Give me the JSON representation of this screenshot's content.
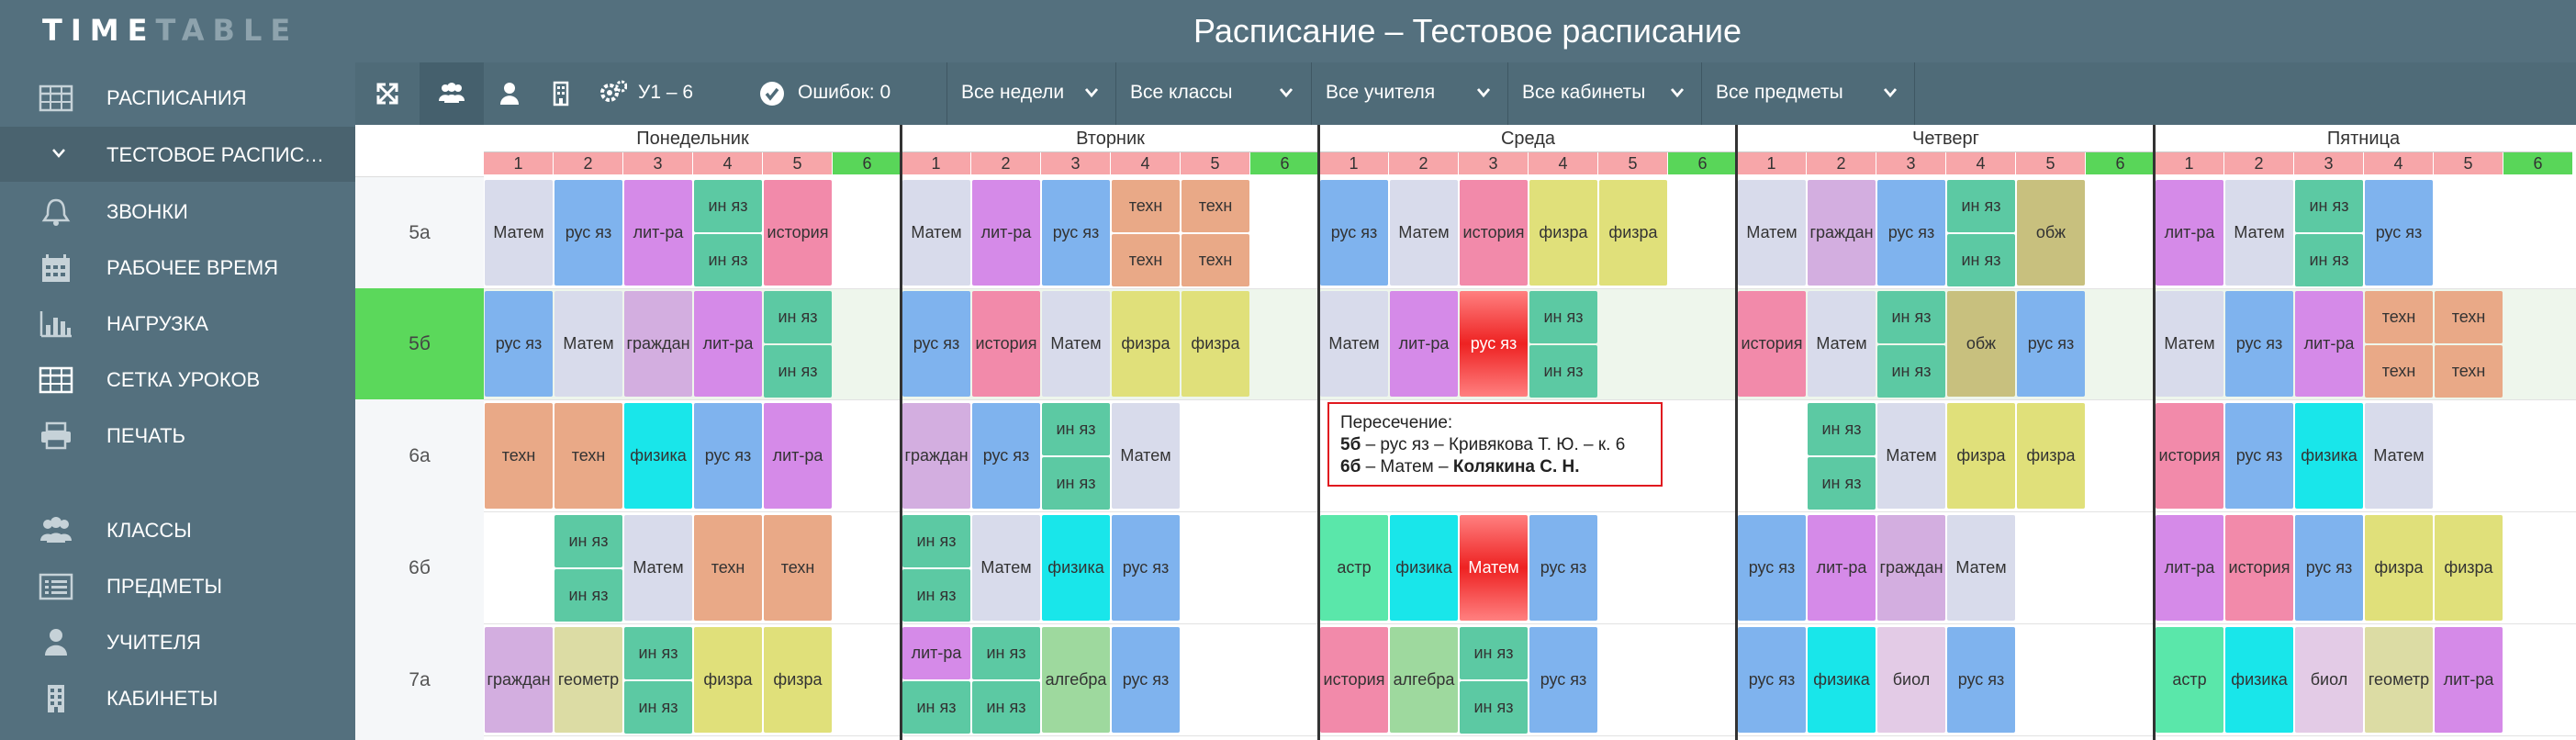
{
  "app": {
    "logo_part1": "TIME",
    "logo_part2": "TABLE",
    "title": "Расписание – Тестовое расписание"
  },
  "sidebar": {
    "items": [
      {
        "label": "РАСПИСАНИЯ",
        "icon": "table-icon"
      },
      {
        "label": "ТЕСТОВОЕ РАСПИСАНИЕ",
        "icon": "chevron-down-icon"
      },
      {
        "label": "ЗВОНКИ",
        "icon": "bell-icon"
      },
      {
        "label": "РАБОЧЕЕ ВРЕМЯ",
        "icon": "calendar-icon"
      },
      {
        "label": "НАГРУЗКА",
        "icon": "bar-chart-icon"
      },
      {
        "label": "СЕТКА УРОКОВ",
        "icon": "grid-icon"
      },
      {
        "label": "ПЕЧАТЬ",
        "icon": "printer-icon"
      },
      {
        "label": "КЛАССЫ",
        "icon": "group-icon"
      },
      {
        "label": "ПРЕДМЕТЫ",
        "icon": "list-icon"
      },
      {
        "label": "УЧИТЕЛЯ",
        "icon": "user-icon"
      },
      {
        "label": "КАБИНЕТЫ",
        "icon": "building-icon"
      }
    ]
  },
  "toolbar": {
    "range": "У1 – 6",
    "errors": "Ошибок: 0",
    "filters": [
      "Все недели",
      "Все классы",
      "Все учителя",
      "Все кабинеты",
      "Все предметы"
    ],
    "icons": [
      "expand-icon",
      "group-view-icon",
      "user-view-icon",
      "building-view-icon",
      "settings-icon",
      "check-circle-icon"
    ]
  },
  "days": [
    "Понедельник",
    "Вторник",
    "Среда",
    "Четверг",
    "Пятница"
  ],
  "periods": [
    "1",
    "2",
    "3",
    "4",
    "5",
    "6"
  ],
  "classes": [
    "5а",
    "5б",
    "6а",
    "6б",
    "7а"
  ],
  "schedule": [
    [
      [
        [
          "Матем"
        ],
        [
          "рус яз"
        ],
        [
          "лит-ра"
        ],
        [
          "ин яз",
          "ин яз"
        ],
        [
          "история"
        ],
        []
      ],
      [
        [
          "Матем"
        ],
        [
          "лит-ра"
        ],
        [
          "рус яз"
        ],
        [
          "техн",
          "техн"
        ],
        [
          "техн",
          "техн"
        ],
        []
      ],
      [
        [
          "рус яз"
        ],
        [
          "Матем"
        ],
        [
          "история"
        ],
        [
          "физра"
        ],
        [
          "физра"
        ],
        []
      ],
      [
        [
          "Матем"
        ],
        [
          "граждан"
        ],
        [
          "рус яз"
        ],
        [
          "ин яз",
          "ин яз"
        ],
        [
          "обж"
        ],
        []
      ],
      [
        [
          "лит-ра"
        ],
        [
          "Матем"
        ],
        [
          "ин яз",
          "ин яз"
        ],
        [
          "рус яз"
        ],
        [],
        []
      ]
    ],
    [
      [
        [
          "рус яз"
        ],
        [
          "Матем"
        ],
        [
          "граждан"
        ],
        [
          "лит-ра"
        ],
        [
          "ин яз",
          "ин яз"
        ],
        []
      ],
      [
        [
          "рус яз"
        ],
        [
          "история"
        ],
        [
          "Матем"
        ],
        [
          "физра"
        ],
        [
          "физра"
        ],
        []
      ],
      [
        [
          "Матем"
        ],
        [
          "лит-ра"
        ],
        [
          "рус яз"
        ],
        [
          "ин яз",
          "ин яз"
        ],
        [],
        []
      ],
      [
        [
          "история"
        ],
        [
          "Матем"
        ],
        [
          "ин яз",
          "ин яз"
        ],
        [
          "обж"
        ],
        [
          "рус яз"
        ],
        []
      ],
      [
        [
          "Матем"
        ],
        [
          "рус яз"
        ],
        [
          "лит-ра"
        ],
        [
          "техн",
          "техн"
        ],
        [
          "техн",
          "техн"
        ],
        []
      ]
    ],
    [
      [
        [
          "техн"
        ],
        [
          "техн"
        ],
        [
          "физика"
        ],
        [
          "рус яз"
        ],
        [
          "лит-ра"
        ],
        []
      ],
      [
        [
          "граждан"
        ],
        [
          "рус яз"
        ],
        [
          "ин яз",
          "ин яз"
        ],
        [
          "Матем"
        ],
        [],
        []
      ],
      [
        [],
        [],
        [],
        [],
        [],
        []
      ],
      [
        [],
        [
          "ин яз",
          "ин яз"
        ],
        [
          "Матем"
        ],
        [
          "физра"
        ],
        [
          "физра"
        ],
        []
      ],
      [
        [
          "история"
        ],
        [
          "рус яз"
        ],
        [
          "физика"
        ],
        [
          "Матем"
        ],
        [],
        []
      ]
    ],
    [
      [
        [],
        [
          "ин яз",
          "ин яз"
        ],
        [
          "Матем"
        ],
        [
          "техн"
        ],
        [
          "техн"
        ],
        []
      ],
      [
        [
          "ин яз",
          "ин яз"
        ],
        [
          "Матем"
        ],
        [
          "физика"
        ],
        [
          "рус яз"
        ],
        [],
        []
      ],
      [
        [
          "астр"
        ],
        [
          "физика"
        ],
        [
          "Матем"
        ],
        [
          "рус яз"
        ],
        [],
        []
      ],
      [
        [
          "рус яз"
        ],
        [
          "лит-ра"
        ],
        [
          "граждан"
        ],
        [
          "Матем"
        ],
        [],
        []
      ],
      [
        [
          "лит-ра"
        ],
        [
          "история"
        ],
        [
          "рус яз"
        ],
        [
          "физра"
        ],
        [
          "физра"
        ],
        []
      ]
    ],
    [
      [
        [
          "граждан"
        ],
        [
          "геометр"
        ],
        [
          "ин яз",
          "ин яз"
        ],
        [
          "физра"
        ],
        [
          "физра"
        ],
        []
      ],
      [
        [
          "лит-ра",
          "ин яз"
        ],
        [
          "ин яз",
          "ин яз"
        ],
        [
          "алгебра"
        ],
        [
          "рус яз"
        ],
        [],
        []
      ],
      [
        [
          "история"
        ],
        [
          "алгебра"
        ],
        [
          "ин яз",
          "ин яз"
        ],
        [
          "рус яз"
        ],
        [],
        []
      ],
      [
        [
          "рус яз"
        ],
        [
          "физика"
        ],
        [
          "биол"
        ],
        [
          "рус яз"
        ],
        [],
        []
      ],
      [
        [
          "астр"
        ],
        [
          "физика"
        ],
        [
          "биол"
        ],
        [
          "геометр"
        ],
        [
          "лит-ра"
        ],
        []
      ]
    ]
  ],
  "conflicts": [
    {
      "row": 1,
      "day": 2,
      "period": 2
    },
    {
      "row": 3,
      "day": 2,
      "period": 2
    }
  ],
  "subject_colors": {
    "Матем": "#d8dbeb",
    "рус яз": "#7fb3ee",
    "лит-ра": "#d58ae8",
    "ин яз": "#5cc9a3",
    "история": "#f28aaa",
    "техн": "#e9a987",
    "физра": "#e0e07a",
    "граждан": "#d3aee0",
    "обж": "#c8c07e",
    "физика": "#19e6ea",
    "астр": "#5ae7aa",
    "алгебра": "#9ed99e",
    "геометр": "#dcdca4",
    "биол": "#e3cbe6"
  },
  "colors": {
    "period_header_normal": "#f7a6a9",
    "period_header_free": "#59d659",
    "row_highlight": "#eef6ec"
  },
  "tooltip": {
    "title": "Пересечение:",
    "line1_class": "5б",
    "line1_rest": " – рус яз – Кривякова Т. Ю. – к. 6",
    "line2_class": "6б",
    "line2_mid": " – Матем – ",
    "line2_teacher": "Колякина С. Н."
  }
}
